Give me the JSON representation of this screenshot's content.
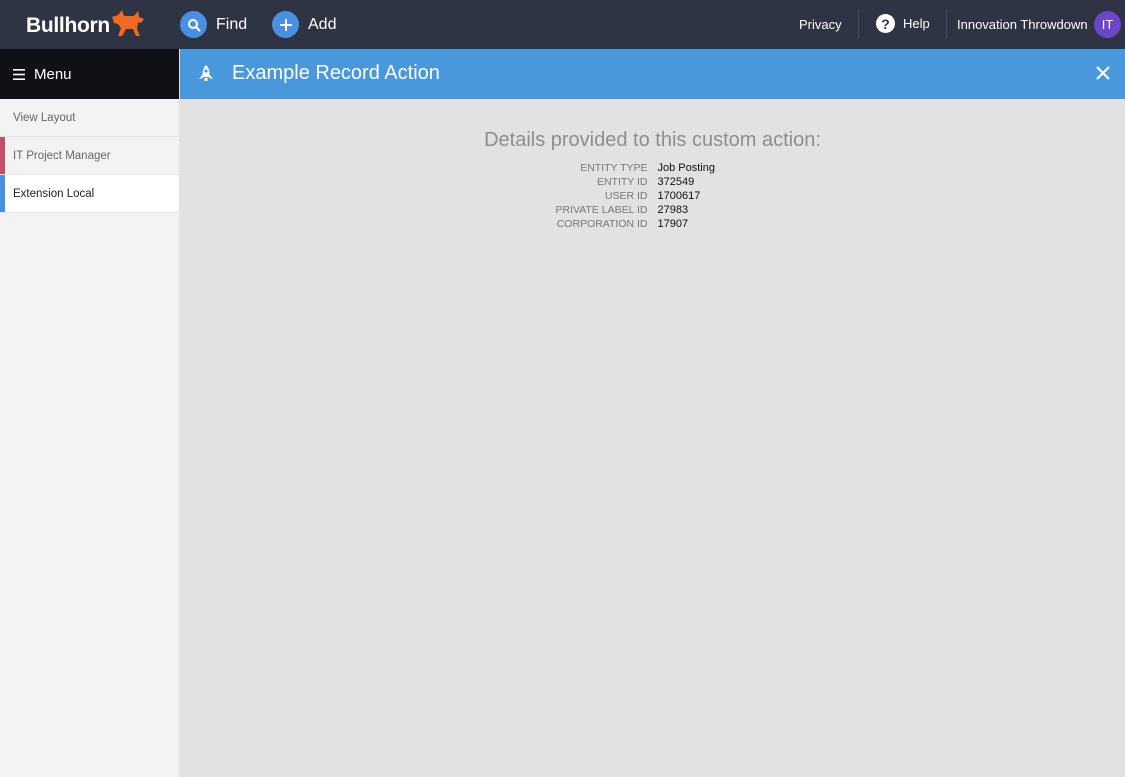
{
  "topbar": {
    "logo_text": "Bullhorn",
    "find_label": "Find",
    "add_label": "Add",
    "privacy_label": "Privacy",
    "help_label": "Help",
    "user_name": "Innovation Throwdown",
    "avatar_initials": "IT",
    "brand_orange": "#f26a21",
    "accent_blue": "#4a90e2"
  },
  "sidebar": {
    "menu_label": "Menu",
    "items": [
      {
        "label": "View Layout",
        "color": ""
      },
      {
        "label": "IT Project Manager",
        "color": "#c0506a"
      },
      {
        "label": "Extension Local",
        "color": "#4a90e2"
      }
    ]
  },
  "main": {
    "title": "Example Record Action",
    "details_title": "Details provided to this custom action:",
    "details": [
      {
        "key": "ENTITY TYPE",
        "value": "Job Posting"
      },
      {
        "key": "ENTITY ID",
        "value": "372549"
      },
      {
        "key": "USER ID",
        "value": "1700617"
      },
      {
        "key": "PRIVATE LABEL ID",
        "value": "27983"
      },
      {
        "key": "CORPORATION ID",
        "value": "17907"
      }
    ]
  }
}
